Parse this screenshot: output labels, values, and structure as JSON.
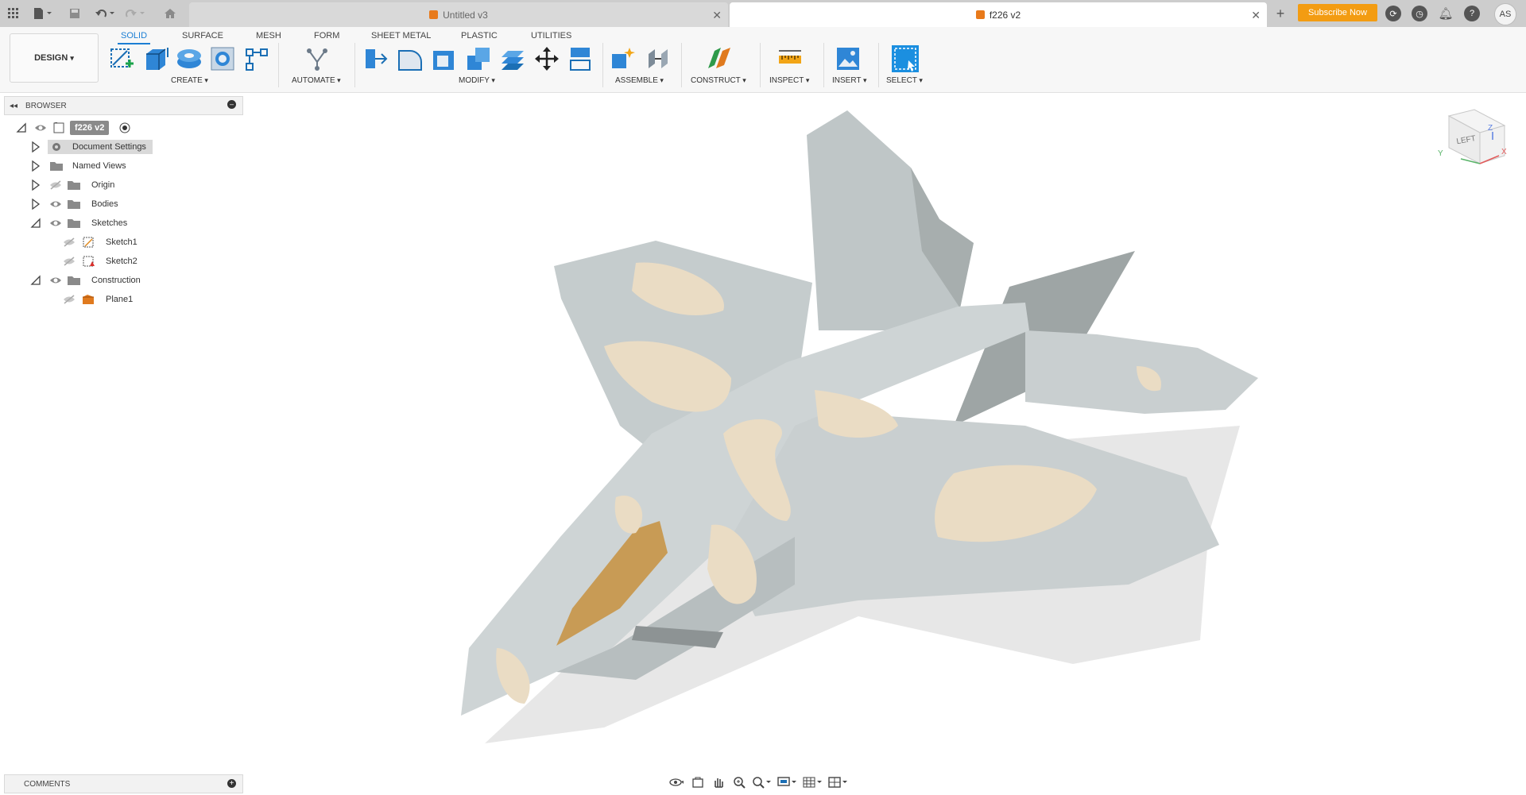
{
  "app": {
    "tabs": [
      {
        "label": "Untitled v3",
        "active": false
      },
      {
        "label": "f226 v2",
        "active": true
      }
    ],
    "subscribe_label": "Subscribe Now",
    "user_initials": "AS"
  },
  "toolbar": {
    "workspace": "DESIGN",
    "tabs": [
      "SOLID",
      "SURFACE",
      "MESH",
      "FORM",
      "SHEET METAL",
      "PLASTIC",
      "UTILITIES"
    ],
    "active_tab": "SOLID",
    "groups": {
      "create": "CREATE",
      "automate": "AUTOMATE",
      "modify": "MODIFY",
      "assemble": "ASSEMBLE",
      "construct": "CONSTRUCT",
      "inspect": "INSPECT",
      "insert": "INSERT",
      "select": "SELECT"
    }
  },
  "browser": {
    "title": "BROWSER",
    "root": "f226 v2",
    "items": [
      {
        "label": "Document Settings"
      },
      {
        "label": "Named Views"
      },
      {
        "label": "Origin"
      },
      {
        "label": "Bodies"
      },
      {
        "label": "Sketches"
      },
      {
        "label": "Sketch1"
      },
      {
        "label": "Sketch2"
      },
      {
        "label": "Construction"
      },
      {
        "label": "Plane1"
      }
    ]
  },
  "comments": {
    "title": "COMMENTS"
  },
  "viewcube": {
    "face": "LEFT",
    "x": "X",
    "y": "Y",
    "z": "Z"
  },
  "colors": {
    "accent": "#1b7ed4",
    "subscribe": "#f39c12",
    "jet_body": "#c9cfd0",
    "camo": "#eadcc4",
    "canopy": "#c89b55"
  }
}
